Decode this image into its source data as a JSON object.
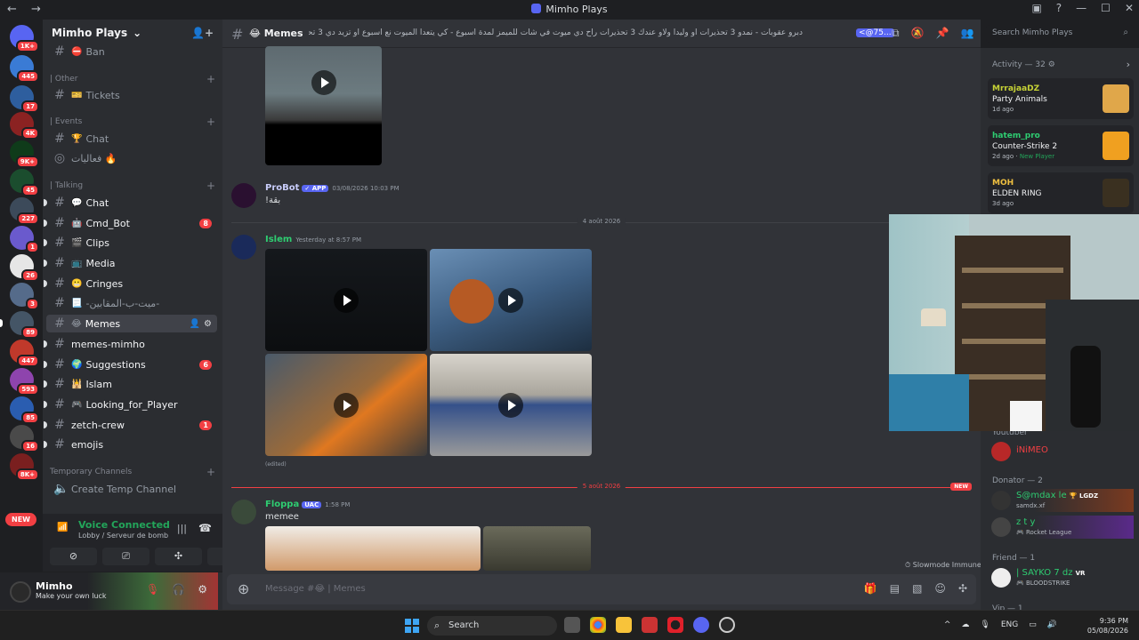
{
  "window": {
    "title": "Mimho Plays",
    "nav": "← →"
  },
  "server": {
    "name": "Mimho Plays"
  },
  "guild_badges": [
    "1K+",
    "445",
    "17",
    "4K",
    "9K+",
    "45",
    "227",
    "1",
    "26",
    "3",
    "89",
    "447",
    "593",
    "85",
    "16",
    "8K+"
  ],
  "guild_new_label": "NEW",
  "categories": {
    "other": "| Other",
    "events": "| Events",
    "talking": "| Talking",
    "temp": "Temporary Channels"
  },
  "channels": [
    {
      "label": "Ban",
      "emoji": "⛔"
    },
    {
      "label": "Tickets",
      "emoji": "🎫"
    },
    {
      "label": "Chat",
      "emoji": "🏆"
    },
    {
      "label": "فعاليات 🔥",
      "emoji": ""
    },
    {
      "label": "Chat",
      "emoji": "💬"
    },
    {
      "label": "Cmd_Bot",
      "emoji": "🤖",
      "count": "8"
    },
    {
      "label": "Clips",
      "emoji": "🎬"
    },
    {
      "label": "Media",
      "emoji": "📺"
    },
    {
      "label": "Cringes",
      "emoji": "😬"
    },
    {
      "label": "-ميت-ب-المقابين-",
      "emoji": "📃"
    },
    {
      "label": "Memes",
      "emoji": "😂"
    },
    {
      "label": "memes-mimho",
      "emoji": ""
    },
    {
      "label": "Suggestions",
      "emoji": "🌍",
      "count": "6"
    },
    {
      "label": "Islam",
      "emoji": "🕌"
    },
    {
      "label": "Looking_for_Player",
      "emoji": "🎮"
    },
    {
      "label": "zetch-crew",
      "emoji": "",
      "count": "1"
    },
    {
      "label": "emojis",
      "emoji": ""
    }
  ],
  "create_temp": "Create Temp Channel",
  "voice": {
    "status": "Voice Connected",
    "location": "Lobby / Serveur de bomb"
  },
  "user": {
    "name": "Mimho",
    "status": "Make your own luck"
  },
  "header": {
    "channel": "Memes",
    "topic": "دبرو عقوبات - نمدو 3 تحذيرات او وليدا ولاو عندك 3 تحذيرات راح دي ميوت في شات للميمز لمدة اسبوع - كي يتعدا الميوت نع اسبوع او تزيد دي 3 تحذيرات اخرى راح دي ميوت نع شهر من شات لميمز",
    "ping": "<@75..."
  },
  "search": {
    "placeholder": "Search Mimho Plays"
  },
  "messages": [
    {
      "author": "ProBot",
      "tag": "✓ APP",
      "time": "03/08/2026 10:03 PM",
      "text": "!بقة"
    },
    {
      "author": "Islem",
      "time": "Yesterday at 8:57 PM",
      "edited": "(edited)"
    },
    {
      "author": "Floppa",
      "tag": "UAC",
      "time": "1:58 PM",
      "text": "memee"
    }
  ],
  "dividers": {
    "first": "4 août 2026",
    "second": "5 août 2026",
    "new": "NEW"
  },
  "composer": {
    "placeholder": "Message #😂 | Memes"
  },
  "slowmode": "Slowmode Immune",
  "members": {
    "activity_title": "Activity — 32",
    "activities": [
      {
        "user": "MrrajaaDZ",
        "game": "Party Animals",
        "when": "1d ago"
      },
      {
        "user": "hatem_pro",
        "game": "Counter-Strike 2",
        "when": "2d ago",
        "extra": "New Player"
      },
      {
        "user": "MOH",
        "game": "ELDEN RING",
        "when": "3d ago"
      }
    ],
    "youtuber_title": "Youtuber",
    "youtuber": {
      "name": "iNiMEO"
    },
    "donator_title": "Donator — 2",
    "donators": [
      {
        "name": "S@mdax le",
        "badge": "LGDZ",
        "sub": "samdx.xf"
      },
      {
        "name": "z t y",
        "sub": "Rocket League"
      }
    ],
    "friend_title": "Friend — 1",
    "friend": {
      "name": "| SAYKO 7 dz",
      "badge": "VR",
      "sub": "BLOODSTRIKE"
    },
    "vip_title": "Vip — 1"
  },
  "taskbar": {
    "search": "Search",
    "lang": "ENG",
    "time": "9:36 PM",
    "date": "05/08/2026"
  }
}
